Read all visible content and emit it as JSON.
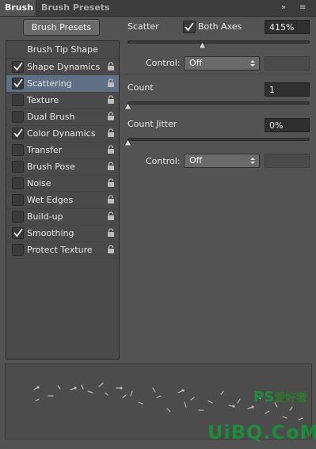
{
  "tabs": [
    {
      "label": "Brush"
    },
    {
      "label": "Brush Presets"
    }
  ],
  "panel_menu_glyphs": {
    "collapse": "»",
    "menu": "≡"
  },
  "left": {
    "presets_button": "Brush Presets",
    "header": "Brush Tip Shape",
    "options": [
      {
        "label": "Shape Dynamics",
        "checked": true,
        "selected": false
      },
      {
        "label": "Scattering",
        "checked": true,
        "selected": true
      },
      {
        "label": "Texture",
        "checked": false,
        "selected": false
      },
      {
        "label": "Dual Brush",
        "checked": false,
        "selected": false
      },
      {
        "label": "Color Dynamics",
        "checked": true,
        "selected": false
      },
      {
        "label": "Transfer",
        "checked": false,
        "selected": false
      },
      {
        "label": "Brush Pose",
        "checked": false,
        "selected": false
      },
      {
        "label": "Noise",
        "checked": false,
        "selected": false
      },
      {
        "label": "Wet Edges",
        "checked": false,
        "selected": false
      },
      {
        "label": "Build-up",
        "checked": false,
        "selected": false
      },
      {
        "label": "Smoothing",
        "checked": true,
        "selected": false
      },
      {
        "label": "Protect Texture",
        "checked": false,
        "selected": false
      }
    ]
  },
  "right": {
    "scatter": {
      "label": "Scatter",
      "both_axes_label": "Both Axes",
      "both_axes_checked": true,
      "value": "415%"
    },
    "control1": {
      "label": "Control:",
      "value": "Off"
    },
    "count": {
      "label": "Count",
      "value": "1"
    },
    "count_jitter": {
      "label": "Count Jitter",
      "value": "0%"
    },
    "control2": {
      "label": "Control:",
      "value": "Off"
    }
  },
  "watermark": {
    "line1": "PS",
    "line1_cn": "爱好者",
    "line2": "UiBQ.CoM"
  },
  "colors": {
    "selected_row": "#5f6f85",
    "panel_bg": "#535353",
    "watermark": "#1f8a3a"
  }
}
